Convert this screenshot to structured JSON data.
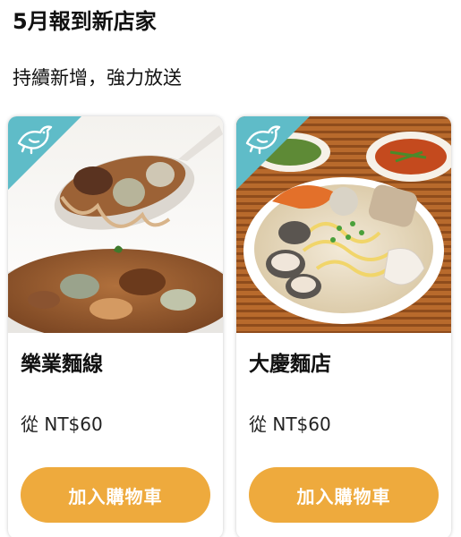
{
  "section": {
    "title": "5月報到新店家",
    "subtitle": "持續新增，強力放送"
  },
  "colors": {
    "accent": "#eeaa3d",
    "ribbon": "#5fbcc8",
    "text": "#111111"
  },
  "stores": [
    {
      "name": "樂業麵線",
      "price": "從 NT$60",
      "cart_label": "加入購物車",
      "badge_icon": "bird-icon"
    },
    {
      "name": "大慶麵店",
      "price": "從 NT$60",
      "cart_label": "加入購物車",
      "badge_icon": "bird-icon"
    }
  ]
}
